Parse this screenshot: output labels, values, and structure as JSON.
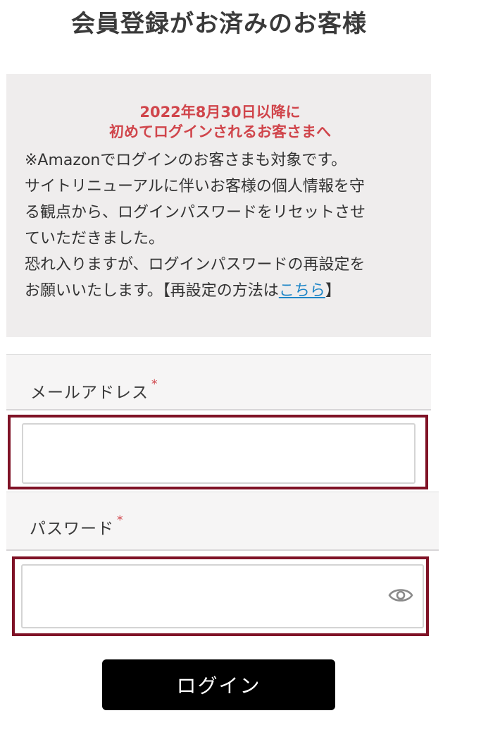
{
  "page": {
    "title": "会員登録がお済みのお客様"
  },
  "notice": {
    "heading_line1": "2022年8月30日以降に",
    "heading_line2": "初めてログインされるお客さまへ",
    "body_line1": "※Amazonでログインのお客さまも対象です。",
    "body_line2": "サイトリニューアルに伴いお客様の個人情報を守",
    "body_line3": "る観点から、ログインパスワードをリセットさせ",
    "body_line4": "ていただきました。",
    "body_line5": "恐れ入りますが、ログインパスワードの再設定を",
    "body_line6_prefix": "お願いいたします。【再設定の方法は",
    "link_text": "こちら",
    "body_line6_suffix": "】"
  },
  "email_field": {
    "label": "メールアドレス",
    "required_mark": "*",
    "value": "",
    "placeholder": ""
  },
  "password_field": {
    "label": "パスワード",
    "required_mark": "*",
    "value": "",
    "placeholder": "",
    "toggle_icon": "eye-icon"
  },
  "login_button": {
    "label": "ログイン"
  },
  "colors": {
    "notice_heading": "#d0454b",
    "link": "#1f86c7",
    "focus_frame": "#7f1226",
    "button_bg": "#000000"
  }
}
